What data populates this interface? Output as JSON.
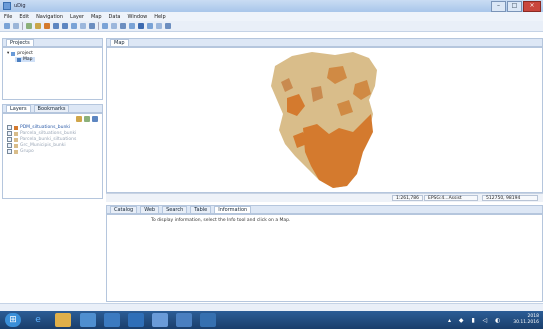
{
  "window": {
    "title": "uDig"
  },
  "menu": [
    "File",
    "Edit",
    "Navigation",
    "Layer",
    "Map",
    "Data",
    "Window",
    "Help"
  ],
  "projects_panel": {
    "tab_label": "Projects",
    "project_name": "project",
    "map_name": "Map"
  },
  "layers_panel": {
    "tabs": [
      "Layers",
      "Bookmarks"
    ],
    "layers": [
      {
        "name": "PDM_siltuations_bunki",
        "active": true
      },
      {
        "name": "Parcela_siltuations_bunki",
        "active": false
      },
      {
        "name": "Parcela_bunki_siltuations",
        "active": false
      },
      {
        "name": "Grc_Municipis_bunki",
        "active": false
      },
      {
        "name": "Grupo",
        "active": false
      }
    ]
  },
  "map_editor": {
    "tab_label": "Map"
  },
  "map_status": {
    "scale": "1:261,786",
    "crs": "EPSG:4...Assist",
    "coords": "512750, 98194"
  },
  "bottom_panel": {
    "tabs": [
      "Catalog",
      "Web",
      "Search",
      "Table",
      "Information"
    ],
    "active_tab": "Information",
    "message": "To display information, select the Info tool and click on a Map."
  },
  "taskbar": {
    "time": "2018",
    "date": "30.11.2016"
  },
  "colors": {
    "map_light": "#d9bd8a",
    "map_dark": "#d47a2e",
    "taskbar": "#1f4a80"
  }
}
